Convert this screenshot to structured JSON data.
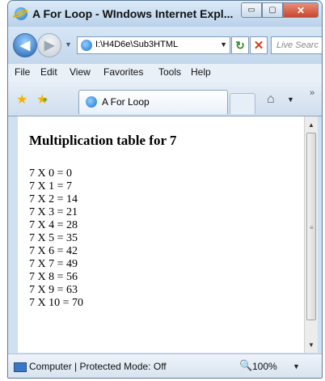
{
  "window": {
    "title": "A For Loop - WIndows Internet Expl...",
    "min": "▭",
    "max": "▢",
    "close": "✕"
  },
  "nav": {
    "address": "I:\\H4D6e\\Sub3HTML",
    "search_placeholder": "Live Searc"
  },
  "menu": {
    "items": [
      "File",
      "Edit",
      "View",
      "Favorites",
      "Tools",
      "Help"
    ]
  },
  "tab": {
    "label": "A For Loop"
  },
  "content": {
    "heading": "Multiplication table for 7",
    "rows": [
      "7 X 0 = 0",
      "7 X 1 = 7",
      "7 X 2 = 14",
      "7 X 3 = 21",
      "7 X 4 = 28",
      "7 X 5 = 35",
      "7 X 6 = 42",
      "7 X 7 = 49",
      "7 X 8 = 56",
      "7 X 9 = 63",
      "7 X 10 = 70"
    ]
  },
  "status": {
    "text": "Computer | Protected Mode: Off",
    "zoom": "100%"
  }
}
